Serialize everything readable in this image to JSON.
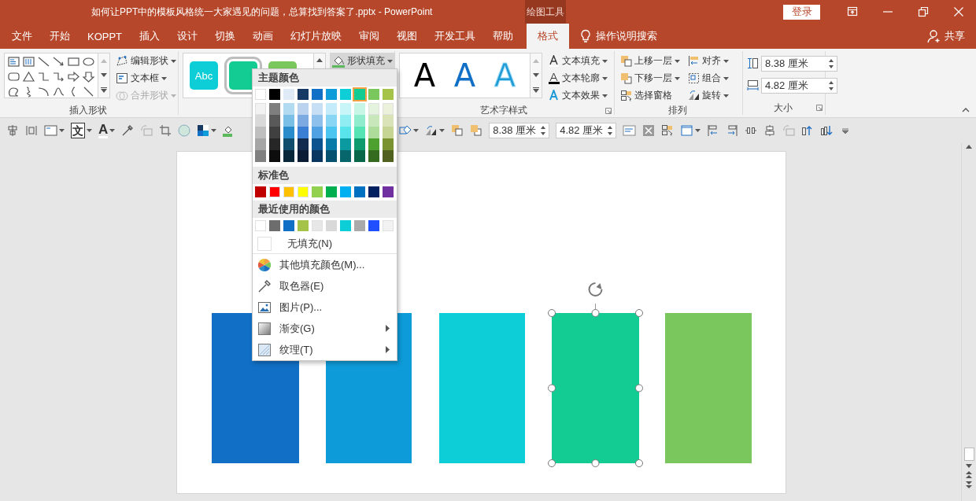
{
  "window": {
    "title": "如何让PPT中的模板风格统一大家遇见的问题，总算找到答案了.pptx  -  PowerPoint",
    "context_tab": "绘图工具",
    "login": "登录"
  },
  "tabs": [
    {
      "label": "文件",
      "selected": false
    },
    {
      "label": "开始",
      "selected": false
    },
    {
      "label": "KOPPT",
      "selected": false
    },
    {
      "label": "插入",
      "selected": false
    },
    {
      "label": "设计",
      "selected": false
    },
    {
      "label": "切换",
      "selected": false
    },
    {
      "label": "动画",
      "selected": false
    },
    {
      "label": "幻灯片放映",
      "selected": false
    },
    {
      "label": "审阅",
      "selected": false
    },
    {
      "label": "视图",
      "selected": false
    },
    {
      "label": "开发工具",
      "selected": false
    },
    {
      "label": "帮助",
      "selected": false
    },
    {
      "label": "格式",
      "selected": true
    }
  ],
  "tell_me": "操作说明搜索",
  "share": "共享",
  "ribbon": {
    "insert_shapes": {
      "label": "插入形状",
      "commands": [
        {
          "label": "编辑形状",
          "disabled": false
        },
        {
          "label": "文本框",
          "disabled": false
        },
        {
          "label": "合并形状",
          "disabled": true
        }
      ]
    },
    "shape_styles": {
      "gallery": [
        {
          "label": "Abc",
          "color": "#0dcdd6",
          "selected": false
        },
        {
          "color": "#12cc93",
          "selected": true
        },
        {
          "color": "#79c75d",
          "selected": false
        }
      ],
      "fill_button": "形状填充"
    },
    "wordart_styles": {
      "label": "艺术字样式",
      "gallery": [
        {
          "label": "A",
          "kind": "fill",
          "color": "#000000"
        },
        {
          "label": "A",
          "kind": "fill",
          "color": "#1170c6"
        },
        {
          "label": "A",
          "kind": "outline",
          "color": "#1e9ad6"
        }
      ],
      "commands": [
        "文本填充",
        "文本轮廓",
        "文本效果"
      ]
    },
    "arrange": {
      "label": "排列",
      "commands": [
        "上移一层",
        "下移一层",
        "选择窗格",
        "对齐",
        "组合",
        "旋转"
      ]
    },
    "size": {
      "label": "大小",
      "height": "8.38 厘米",
      "width": "4.82 厘米"
    }
  },
  "quick_toolbar": {
    "text_direction": "文",
    "font_color": "A",
    "height": "8.38 厘米",
    "width": "4.82 厘米"
  },
  "fill_menu": {
    "theme_heading": "主题颜色",
    "theme_colors": [
      {
        "color": "#ffffff",
        "selected": false,
        "tints": [
          {
            "color": "#f2f2f2",
            "selected": false
          },
          {
            "color": "#d9d9d9",
            "selected": false
          },
          {
            "color": "#bfbfbf",
            "selected": false
          },
          {
            "color": "#a6a6a6",
            "selected": false
          },
          {
            "color": "#808080",
            "selected": false
          }
        ]
      },
      {
        "color": "#000000",
        "selected": false,
        "tints": [
          {
            "color": "#7f7f7f",
            "selected": false
          },
          {
            "color": "#595959",
            "selected": false
          },
          {
            "color": "#404040",
            "selected": false
          },
          {
            "color": "#262626",
            "selected": false
          },
          {
            "color": "#0d0d0d",
            "selected": false
          }
        ]
      },
      {
        "color": "#deebf7",
        "selected": false,
        "tints": [
          {
            "color": "#b2daf0",
            "selected": false
          },
          {
            "color": "#79bfe6",
            "selected": false
          },
          {
            "color": "#2a8ccb",
            "selected": false
          },
          {
            "color": "#104c6c",
            "selected": false
          },
          {
            "color": "#08283a",
            "selected": false
          }
        ]
      },
      {
        "color": "#163a64",
        "selected": false,
        "tints": [
          {
            "color": "#bcd3f0",
            "selected": false
          },
          {
            "color": "#7eaae2",
            "selected": false
          },
          {
            "color": "#3b7fd4",
            "selected": false
          },
          {
            "color": "#112a4e",
            "selected": false
          },
          {
            "color": "#0b1c34",
            "selected": false
          }
        ]
      },
      {
        "color": "#1170c6",
        "selected": false,
        "tints": [
          {
            "color": "#c6dff5",
            "selected": false
          },
          {
            "color": "#8ec0ec",
            "selected": false
          },
          {
            "color": "#50a0e4",
            "selected": false
          },
          {
            "color": "#0c528f",
            "selected": false
          },
          {
            "color": "#083660",
            "selected": false
          }
        ]
      },
      {
        "color": "#0e9bd9",
        "selected": false,
        "tints": [
          {
            "color": "#c4ebfa",
            "selected": false
          },
          {
            "color": "#88d6f4",
            "selected": false
          },
          {
            "color": "#4cc5f0",
            "selected": false
          },
          {
            "color": "#0a7aa8",
            "selected": false
          },
          {
            "color": "#065170",
            "selected": false
          }
        ]
      },
      {
        "color": "#0dcdd6",
        "selected": false,
        "tints": [
          {
            "color": "#c8f6f8",
            "selected": false
          },
          {
            "color": "#90edf1",
            "selected": false
          },
          {
            "color": "#58e4ea",
            "selected": false
          },
          {
            "color": "#0a9aa0",
            "selected": false
          },
          {
            "color": "#06666b",
            "selected": false
          }
        ]
      },
      {
        "color": "#12cc93",
        "selected": true,
        "tints": [
          {
            "color": "#c7f6e6",
            "selected": false
          },
          {
            "color": "#8fedcd",
            "selected": false
          },
          {
            "color": "#57e4b4",
            "selected": false
          },
          {
            "color": "#0d9a6d",
            "selected": false
          },
          {
            "color": "#086749",
            "selected": false
          }
        ]
      },
      {
        "color": "#79c75d",
        "selected": false,
        "tints": [
          {
            "color": "#e3f3dd",
            "selected": false
          },
          {
            "color": "#c8e8bc",
            "selected": false
          },
          {
            "color": "#aedd9b",
            "selected": false
          },
          {
            "color": "#4fa12f",
            "selected": false
          },
          {
            "color": "#346b1f",
            "selected": false
          }
        ]
      },
      {
        "color": "#a5c249",
        "selected": false,
        "tints": [
          {
            "color": "#ecf1db",
            "selected": false
          },
          {
            "color": "#d9e3b7",
            "selected": false
          },
          {
            "color": "#c7d594",
            "selected": false
          },
          {
            "color": "#7a9230",
            "selected": false
          },
          {
            "color": "#516120",
            "selected": false
          }
        ]
      }
    ],
    "standard_heading": "标准色",
    "standard_colors": [
      {
        "color": "#c00000",
        "selected": false
      },
      {
        "color": "#ff0000",
        "selected": false
      },
      {
        "color": "#ffc000",
        "selected": false
      },
      {
        "color": "#ffff00",
        "selected": false
      },
      {
        "color": "#92d050",
        "selected": false
      },
      {
        "color": "#00b050",
        "selected": false
      },
      {
        "color": "#00b0f0",
        "selected": false
      },
      {
        "color": "#0070c0",
        "selected": false
      },
      {
        "color": "#002060",
        "selected": false
      },
      {
        "color": "#7030a0",
        "selected": false
      }
    ],
    "recent_heading": "最近使用的颜色",
    "recent_colors": [
      {
        "color": "#ffffff",
        "selected": false
      },
      {
        "color": "#6d6d6d",
        "selected": false
      },
      {
        "color": "#1170c6",
        "selected": false
      },
      {
        "color": "#a5c249",
        "selected": false
      },
      {
        "color": "#e7e7e7",
        "selected": false
      },
      {
        "color": "#d9d9d9",
        "selected": false
      },
      {
        "color": "#0dcdd6",
        "selected": false
      },
      {
        "color": "#aaaaaa",
        "selected": false
      },
      {
        "color": "#1f4fff",
        "selected": false
      },
      {
        "color": "#f2f2f2",
        "selected": false
      }
    ],
    "items": [
      {
        "kind": "no-fill",
        "label": "无填充(N)",
        "submenu": false
      },
      {
        "kind": "more-colors",
        "label": "其他填充颜色(M)...",
        "submenu": false
      },
      {
        "kind": "eyedropper",
        "label": "取色器(E)",
        "submenu": false
      },
      {
        "kind": "picture",
        "label": "图片(P)...",
        "submenu": false
      },
      {
        "kind": "gradient",
        "label": "渐变(G)",
        "submenu": true
      },
      {
        "kind": "texture",
        "label": "纹理(T)",
        "submenu": true
      }
    ]
  },
  "slide": {
    "shapes": [
      {
        "color": "#1170c6",
        "selected": false
      },
      {
        "color": "#0e9bd9",
        "selected": false
      },
      {
        "color": "#0dcdd6",
        "selected": false
      },
      {
        "color": "#12cc93",
        "selected": true
      },
      {
        "color": "#79c75d",
        "selected": false
      }
    ]
  }
}
